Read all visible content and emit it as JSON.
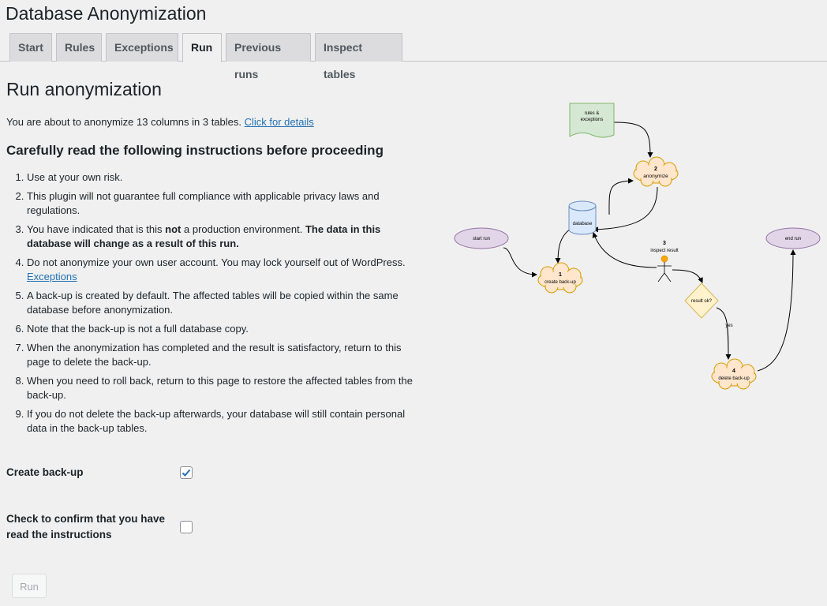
{
  "app": {
    "title": "Database Anonymization"
  },
  "tabs": [
    {
      "label": "Start",
      "active": false
    },
    {
      "label": "Rules",
      "active": false
    },
    {
      "label": "Exceptions",
      "active": false
    },
    {
      "label": "Run",
      "active": true
    },
    {
      "label": "Previous runs",
      "active": false
    },
    {
      "label": "Inspect tables",
      "active": false
    }
  ],
  "main": {
    "title": "Run anonymization",
    "summary_text": "You are about to anonymize 13 columns in 3 tables.",
    "summary_link": "Click for details",
    "warning_title": "Carefully read the following instructions before proceeding",
    "instructions": {
      "i1": "Use at your own risk.",
      "i2": "This plugin will not guarantee full compliance with applicable privacy laws and regulations.",
      "i3_a": "You have indicated that is this",
      "i3_b": "not",
      "i3_c": "a production environment.",
      "i3_d": "The data in this database will change as a result of this run.",
      "i4": "Do not anonymize your own user account. You may lock yourself out of WordPress.",
      "i4_link": "Exceptions",
      "i5": "A back-up is created by default. The affected tables will be copied within the same database before anonymization.",
      "i6": "Note that the back-up is not a full database copy.",
      "i7": "When the anonymization has completed and the result is satisfactory, return to this page to delete the back-up.",
      "i8": "When you need to roll back, return to this page to restore the affected tables from the back-up.",
      "i9": "If you do not delete the back-up afterwards, your database will still contain personal data in the back-up tables."
    }
  },
  "form": {
    "backup_label": "Create back-up",
    "backup_checked": true,
    "confirm_label": "Check to confirm that you have read the instructions",
    "confirm_checked": false,
    "run_label": "Run"
  },
  "flowchart": {
    "rules_line1": "rules &",
    "rules_line2": "exceptions",
    "step2_num": "2",
    "step2_label": "anonymize",
    "database_label": "database",
    "start_label": "start run",
    "end_label": "end run",
    "step1_num": "1",
    "step1_label": "create back-up",
    "step3_num": "3",
    "step3_label": "inspect result",
    "decision_label": "result ok?",
    "yes_label": "yes",
    "step4_num": "4",
    "step4_label": "delete back-up"
  },
  "colors": {
    "accent": "#2271b1",
    "cloud_fill": "#ffe6cc",
    "cloud_stroke": "#d79b00",
    "db_fill": "#dae8fc",
    "db_stroke": "#6c8ebf",
    "doc_fill": "#d5e8d4",
    "doc_stroke": "#82b366",
    "terminal_fill": "#e1d5e7",
    "terminal_stroke": "#9673a6",
    "decision_fill": "#fff2cc",
    "decision_stroke": "#d6b656"
  }
}
